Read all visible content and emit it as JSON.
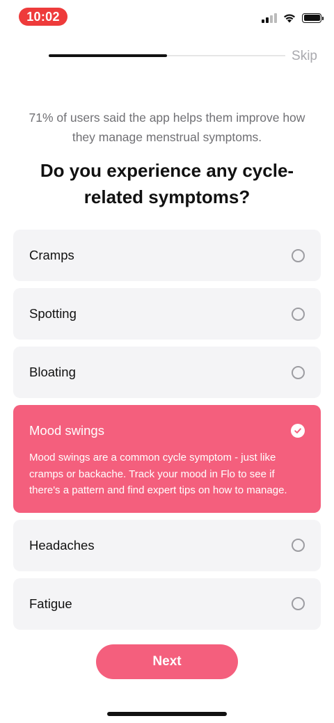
{
  "status_bar": {
    "time": "10:02",
    "battery_percent": 100
  },
  "header": {
    "progress_fraction": 0.5,
    "skip_label": "Skip"
  },
  "stat_text": "71% of users said the app helps them improve how they manage menstrual symptoms.",
  "question": "Do you experience any cycle-related symptoms?",
  "options": [
    {
      "label": "Cramps",
      "selected": false
    },
    {
      "label": "Spotting",
      "selected": false
    },
    {
      "label": "Bloating",
      "selected": false
    },
    {
      "label": "Mood swings",
      "selected": true,
      "description": "Mood swings are a common cycle symptom - just like cramps or backache. Track your mood in Flo to see if there's a pattern and find expert tips on how to manage."
    },
    {
      "label": "Headaches",
      "selected": false
    },
    {
      "label": "Fatigue",
      "selected": false
    }
  ],
  "next_label": "Next",
  "colors": {
    "accent": "#f45f7d",
    "time_pill": "#ee3b3b",
    "option_bg": "#f4f4f6"
  }
}
